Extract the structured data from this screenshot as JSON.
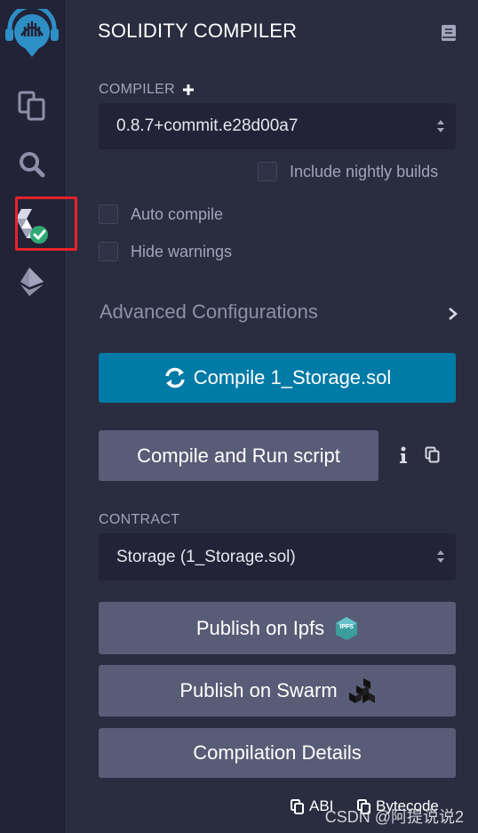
{
  "panel": {
    "title": "SOLIDITY COMPILER",
    "compiler_label": "COMPILER",
    "compiler_version": "0.8.7+commit.e28d00a7",
    "include_nightly_label": "Include nightly builds",
    "auto_compile_label": "Auto compile",
    "hide_warnings_label": "Hide warnings",
    "advanced_label": "Advanced Configurations",
    "compile_button": "Compile 1_Storage.sol",
    "compile_run_button": "Compile and Run script",
    "contract_label": "CONTRACT",
    "contract_value": "Storage (1_Storage.sol)",
    "publish_ipfs_button": "Publish on Ipfs",
    "ipfs_badge": "IPFS",
    "publish_swarm_button": "Publish on Swarm",
    "details_button": "Compilation Details",
    "abi_link": "ABI",
    "bytecode_link": "Bytecode"
  },
  "sidebar": {
    "icons": [
      "remix-logo-icon",
      "file-explorer-icon",
      "search-icon",
      "solidity-compiler-icon",
      "deploy-run-icon"
    ]
  },
  "watermark": "CSDN @阿提说说2",
  "colors": {
    "background": "#2a2c3f",
    "rail": "#222336",
    "primary_button": "#007aa6",
    "secondary_button": "#595c76",
    "active_highlight": "#e8222b",
    "success_badge": "#2fa974",
    "logo_blue": "#2e8fc6"
  }
}
